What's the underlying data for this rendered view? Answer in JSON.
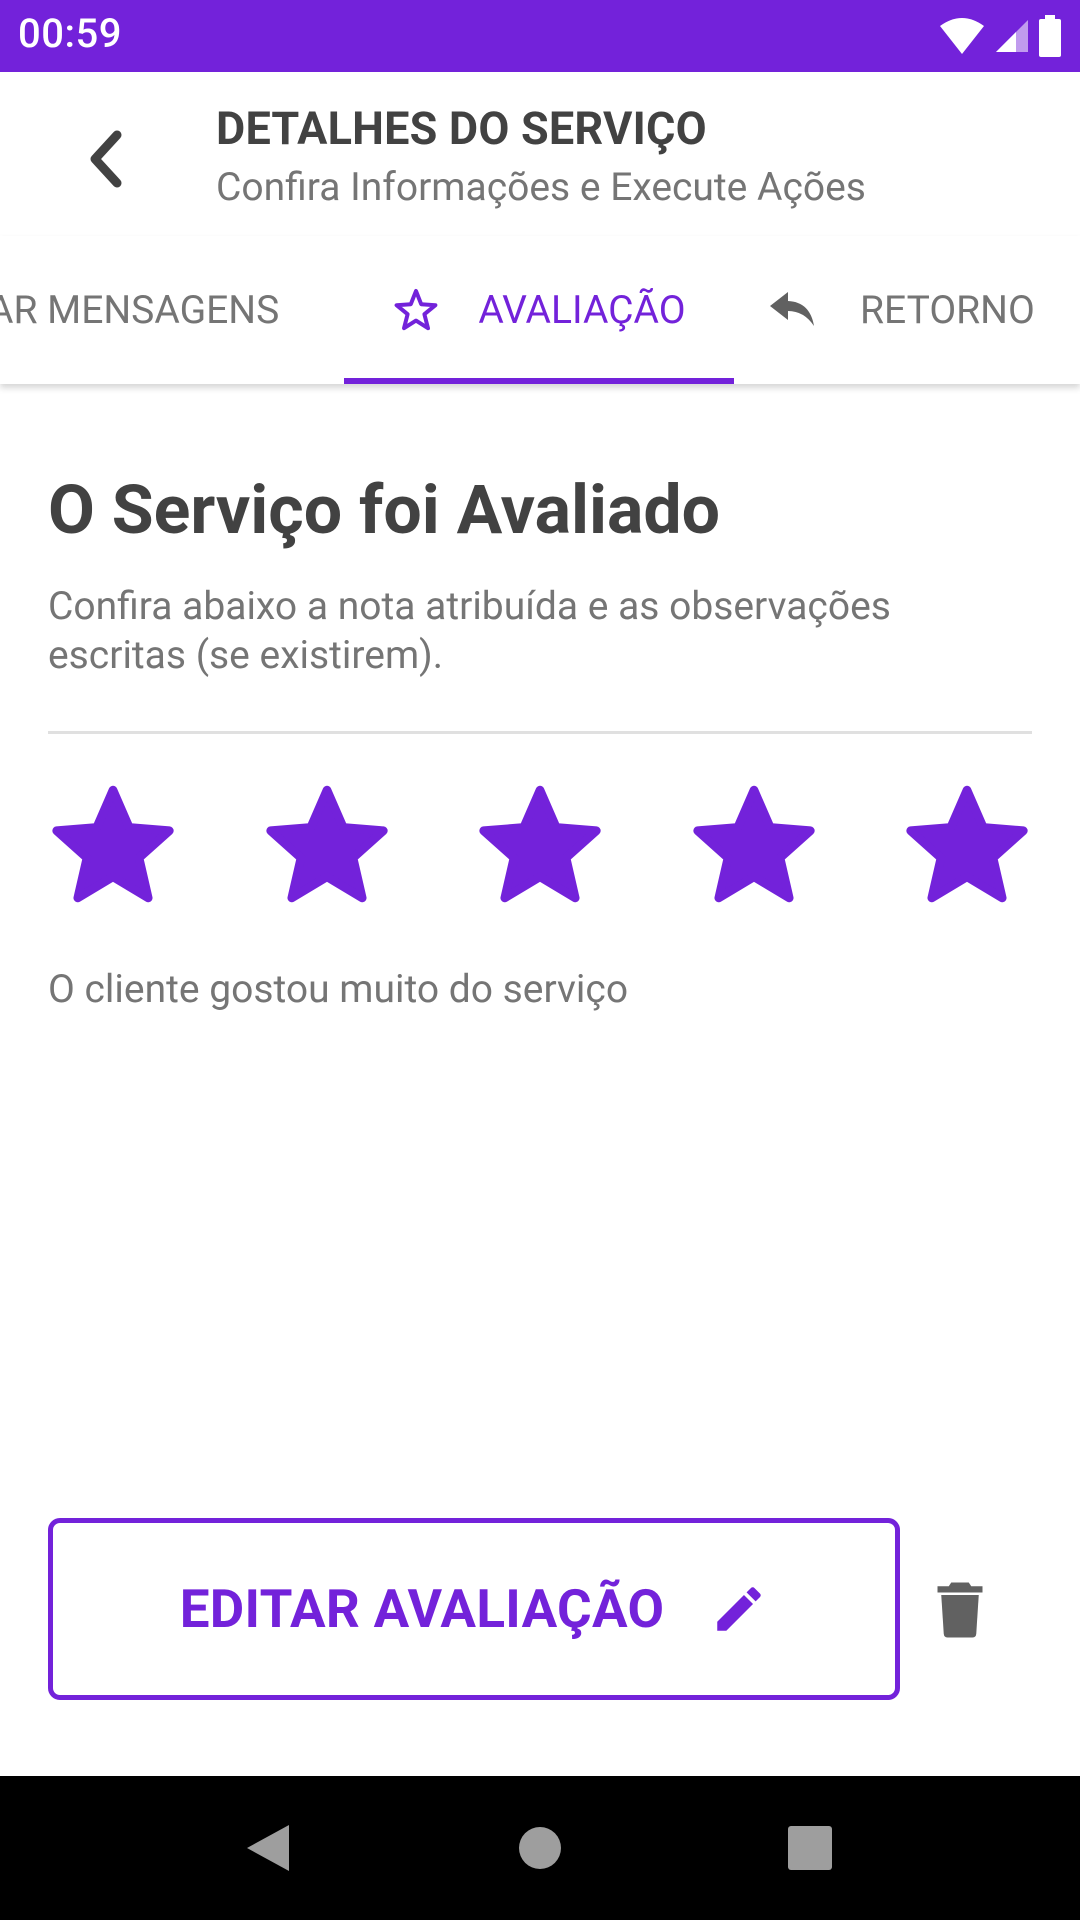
{
  "status_bar": {
    "time": "00:59",
    "color": "#7322da"
  },
  "header": {
    "title": "DETALHES DO SERVIÇO",
    "subtitle": "Confira Informações e Execute Ações",
    "back_icon": "chevron-left-icon"
  },
  "tabs": [
    {
      "label": "AR MENSAGENS",
      "icon": null,
      "selected": false
    },
    {
      "label": "AVALIAÇÃO",
      "icon": "star-outline-icon",
      "selected": true
    },
    {
      "label": "RETORNO",
      "icon": "reply-icon",
      "selected": false
    }
  ],
  "content": {
    "title": "O Serviço foi Avaliado",
    "description": "Confira abaixo a nota atribuída e as observações escritas (se existirem).",
    "rating": 5,
    "rating_max": 5,
    "comment": "O cliente gostou muito do serviço"
  },
  "actions": {
    "edit_label": "EDITAR AVALIAÇÃO",
    "edit_icon": "pencil-icon",
    "delete_icon": "trash-icon"
  },
  "colors": {
    "accent": "#7322da",
    "text_dark": "#424242",
    "text_muted": "#757575"
  }
}
